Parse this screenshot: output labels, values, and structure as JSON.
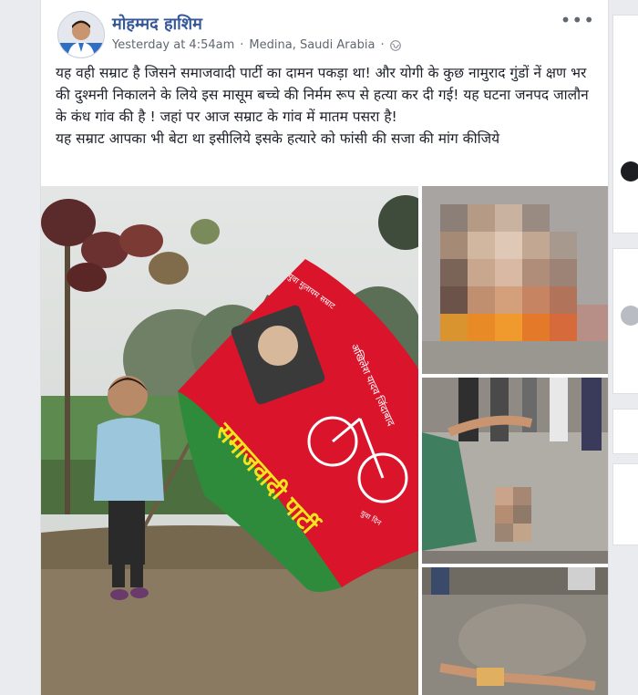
{
  "post": {
    "author": "मोहम्मद हाशिम",
    "time": "Yesterday at 4:54am",
    "separator1": "·",
    "location": "Medina, Saudi Arabia",
    "separator2": "·",
    "more": "•••",
    "text_line1": "यह वही सम्राट है जिसने समाजवादी पार्टी का दामन पकड़ा था! और योगी के कुछ नामुराद गुंडों नें क्षण भर की दुश्मनी निकालने के लिये इस मासूम बच्चे की निर्मम रूप से हत्या कर दी गई! यह घटना जनपद जालौन के कंध गांव की है ! जहां पर आज सम्राट के गांव में मातम पसरा है!",
    "text_line2": "यह सम्राट आपका भी बेटा था इसीलिये इसके हत्यारे को फांसी की सजा की मांग कीजिये"
  },
  "flag": {
    "party_name": "समाजवादी पार्टी",
    "top_text": "युवा मुलायम सम्राट",
    "side_text": "अखिलेश यादव जिंदाबाद",
    "small_text": "युवा दिन"
  },
  "icons": {
    "avatar": "avatar-photo",
    "globe": "globe-icon",
    "more": "more-options-icon"
  },
  "colors": {
    "author": "#365899",
    "flag_red": "#d9142b",
    "flag_green": "#2e8b3b"
  }
}
